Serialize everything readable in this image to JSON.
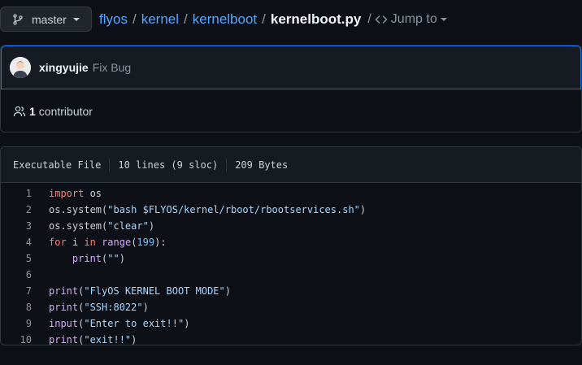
{
  "branch": {
    "label": "master"
  },
  "breadcrumb": {
    "items": [
      "flyos",
      "kernel",
      "kernelboot"
    ],
    "file": "kernelboot.py",
    "separator": "/",
    "jump_label": "Jump to"
  },
  "commit": {
    "author": "xingyujie",
    "message": "Fix Bug"
  },
  "contributors": {
    "count": "1",
    "label": "contributor"
  },
  "file_info": {
    "type": "Executable File",
    "lines": "10 lines (9 sloc)",
    "size": "209 Bytes"
  },
  "code": {
    "line_numbers": [
      "1",
      "2",
      "3",
      "4",
      "5",
      "6",
      "7",
      "8",
      "9",
      "10"
    ],
    "lines": [
      "import os",
      "os.system(\"bash $FLYOS/kernel/rboot/rbootservices.sh\")",
      "os.system(\"clear\")",
      "for i in range(199):",
      "    print(\"\")",
      "",
      "print(\"FlyOS KERNEL BOOT MODE\")",
      "print(\"SSH:8022\")",
      "input(\"Enter to exit!!\")",
      "print(\"exit!!\")"
    ]
  },
  "colors": {
    "background": "#0d1117",
    "link": "#58a6ff",
    "keyword": "#ff7b72",
    "string": "#a5d6ff",
    "builtin": "#d2a8ff",
    "number": "#79c0ff",
    "focus_border": "#1f6feb"
  },
  "icons": [
    "git-branch-icon",
    "code-icon",
    "chevron-down-icon",
    "people-icon",
    "avatar"
  ]
}
